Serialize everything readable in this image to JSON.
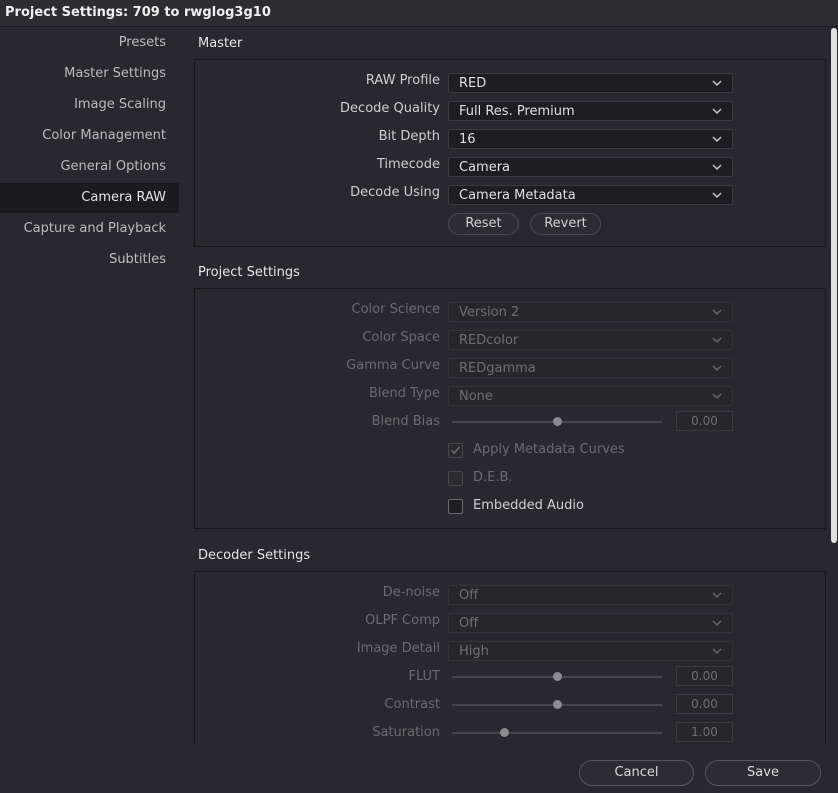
{
  "window": {
    "title": "Project Settings:  709 to rwglog3g10"
  },
  "sidebar": {
    "items": [
      {
        "label": "Presets"
      },
      {
        "label": "Master Settings"
      },
      {
        "label": "Image Scaling"
      },
      {
        "label": "Color Management"
      },
      {
        "label": "General Options"
      },
      {
        "label": "Camera RAW",
        "active": true
      },
      {
        "label": "Capture and Playback"
      },
      {
        "label": "Subtitles"
      }
    ]
  },
  "master": {
    "header": "Master",
    "raw_profile": {
      "label": "RAW Profile",
      "value": "RED"
    },
    "decode_quality": {
      "label": "Decode Quality",
      "value": "Full Res. Premium"
    },
    "bit_depth": {
      "label": "Bit Depth",
      "value": "16"
    },
    "timecode": {
      "label": "Timecode",
      "value": "Camera"
    },
    "decode_using": {
      "label": "Decode Using",
      "value": "Camera Metadata"
    },
    "reset_label": "Reset",
    "revert_label": "Revert"
  },
  "project_settings": {
    "header": "Project Settings",
    "color_science": {
      "label": "Color Science",
      "value": "Version 2"
    },
    "color_space": {
      "label": "Color Space",
      "value": "REDcolor"
    },
    "gamma_curve": {
      "label": "Gamma Curve",
      "value": "REDgamma"
    },
    "blend_type": {
      "label": "Blend Type",
      "value": "None"
    },
    "blend_bias": {
      "label": "Blend Bias",
      "value": "0.00",
      "level": 0.5
    },
    "apply_metadata_curves": {
      "label": "Apply Metadata Curves",
      "checked": true,
      "enabled": false
    },
    "deb": {
      "label": "D.E.B.",
      "checked": false,
      "enabled": false
    },
    "embedded_audio": {
      "label": "Embedded Audio",
      "checked": false,
      "enabled": true
    }
  },
  "decoder_settings": {
    "header": "Decoder Settings",
    "denoise": {
      "label": "De-noise",
      "value": "Off"
    },
    "olpf_comp": {
      "label": "OLPF Comp",
      "value": "Off"
    },
    "image_detail": {
      "label": "Image Detail",
      "value": "High"
    },
    "flut": {
      "label": "FLUT",
      "value": "0.00",
      "level": 0.5
    },
    "contrast": {
      "label": "Contrast",
      "value": "0.00",
      "level": 0.5
    },
    "saturation": {
      "label": "Saturation",
      "value": "1.00",
      "level": 0.25
    }
  },
  "footer": {
    "cancel_label": "Cancel",
    "save_label": "Save"
  },
  "colors": {
    "background": "#28282e",
    "active_nav": "#1c1c20",
    "scrollbar": "#e0e0e0"
  },
  "icons": {
    "dropdown": "chevron-down-icon",
    "check": "checkmark-icon"
  }
}
